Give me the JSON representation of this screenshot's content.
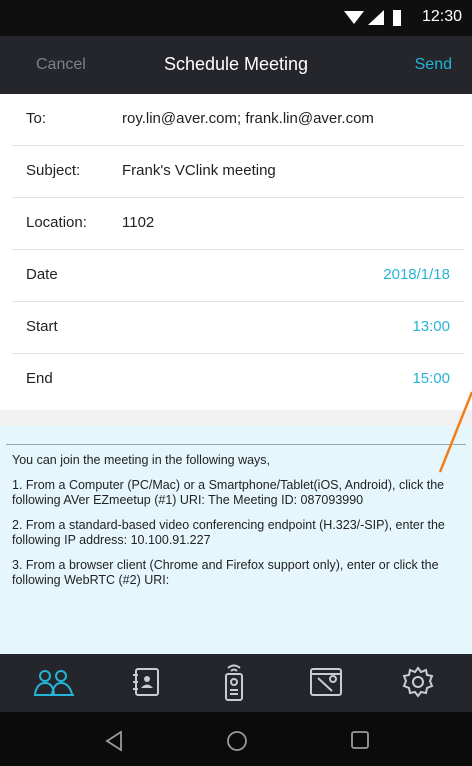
{
  "status_bar": {
    "time": "12:30"
  },
  "header": {
    "cancel_label": "Cancel",
    "title": "Schedule Meeting",
    "send_label": "Send"
  },
  "form": {
    "to_label": "To:",
    "to_value": "roy.lin@aver.com; frank.lin@aver.com",
    "subject_label": "Subject:",
    "subject_value": "Frank's VClink meeting",
    "location_label": "Location:",
    "location_value": "1102",
    "date_label": "Date",
    "date_value": "2018/1/18",
    "start_label": "Start",
    "start_value": "13:00",
    "end_label": "End",
    "end_value": "15:00"
  },
  "body": {
    "intro": "You can join the meeting in the following ways,",
    "item1": "1. From a Computer (PC/Mac) or a Smartphone/Tablet(iOS, Android), click the following AVer EZmeetup (#1) URI: The Meeting ID: 087093990",
    "item2": "2. From a standard-based video conferencing endpoint (H.323/-SIP), enter the following IP address: 10.100.91.227",
    "item3": "3. From a browser client (Chrome and Firefox support only), enter or click the following WebRTC (#2) URI:"
  },
  "tabbar": {
    "icons": [
      "people-icon",
      "contacts-icon",
      "remote-icon",
      "tools-icon",
      "settings-icon"
    ]
  },
  "colors": {
    "accent": "#22b5d8",
    "header_bg": "#24262b",
    "callout": "#f0801e"
  }
}
